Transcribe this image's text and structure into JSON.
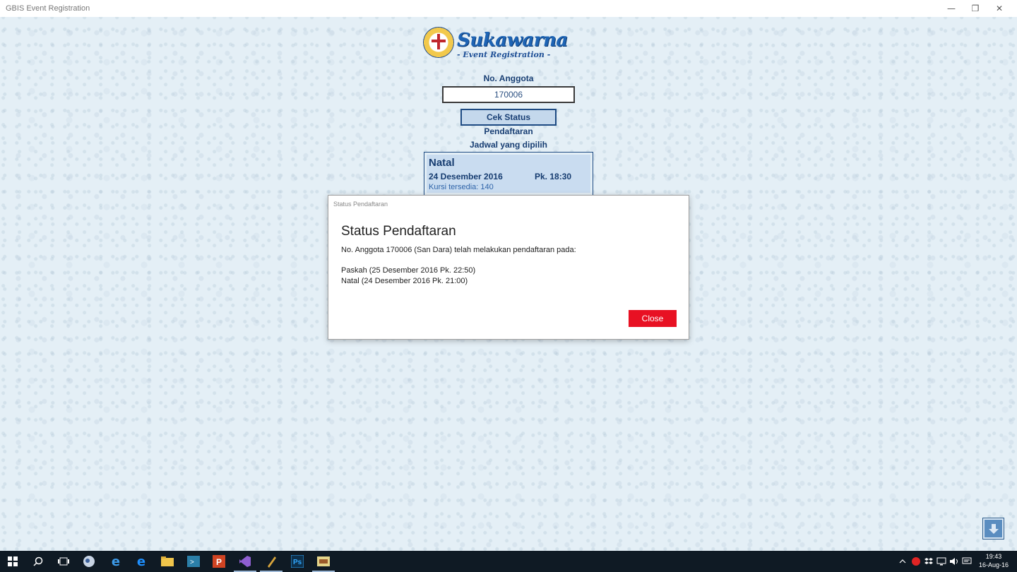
{
  "window": {
    "title": "GBIS Event Registration",
    "minimize_glyph": "—",
    "restore_glyph": "❐",
    "close_glyph": "✕"
  },
  "logo": {
    "brand": "Sukawarna",
    "subtitle": "- Event Registration -"
  },
  "form": {
    "member_label": "No. Anggota",
    "member_value": "170006",
    "check_button": "Cek Status Pendaftaran",
    "schedule_label": "Jadwal yang dipilih"
  },
  "schedule": {
    "event_name": "Natal",
    "date": "24 Desember 2016",
    "time": "Pk. 18:30",
    "seats": "Kursi tersedia: 140"
  },
  "dialog": {
    "caption": "Status Pendaftaran",
    "title": "Status Pendaftaran",
    "message": "No. Anggota 170006 (San Dara) telah melakukan pendaftaran pada:",
    "registrations": [
      "Paskah (25 Desember 2016 Pk. 22:50)",
      "Natal (24 Desember 2016 Pk. 21:00)"
    ],
    "close_button": "Close"
  },
  "taskbar": {
    "apps": [
      "start-icon",
      "search-icon",
      "task-view-icon",
      "app-icon",
      "edge-icon",
      "ie-icon",
      "file-explorer-icon",
      "terminal-icon",
      "powerpoint-icon",
      "visual-studio-icon",
      "blend-icon",
      "photoshop-icon",
      "event-app-icon"
    ],
    "clock_time": "19:43",
    "clock_date": "16-Aug-16"
  },
  "colors": {
    "accent": "#1d4a82",
    "close_button": "#e81123",
    "background": "#e4eff6"
  }
}
